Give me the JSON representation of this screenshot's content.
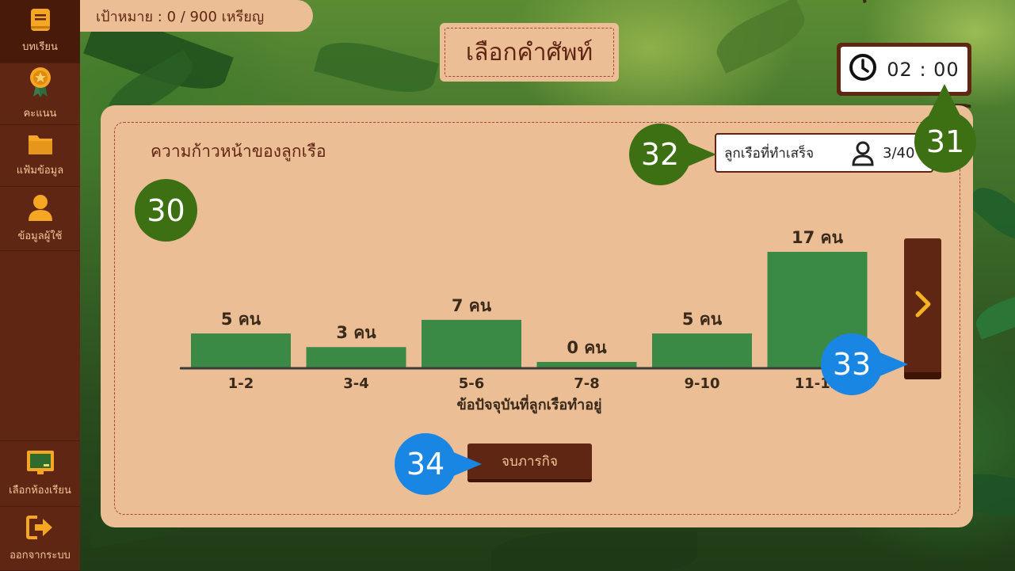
{
  "sidebar": {
    "items": [
      {
        "label": "บทเรียน",
        "icon": "book-icon"
      },
      {
        "label": "คะแนน",
        "icon": "medal-icon"
      },
      {
        "label": "แฟ้มข้อมูล",
        "icon": "folder-icon"
      },
      {
        "label": "ข้อมูลผู้ใช้",
        "icon": "user-icon"
      }
    ],
    "bottom_items": [
      {
        "label": "เลือกห้องเรียน",
        "icon": "classroom-board-icon"
      },
      {
        "label": "ออกจากระบบ",
        "icon": "logout-icon"
      }
    ]
  },
  "header": {
    "goal": "เป้าหมาย : 0 / 900 เหรียญ",
    "title": "เลือกคำศัพท์",
    "timer": "02 : 00"
  },
  "panel": {
    "title": "ความก้าวหน้าของลูกเรือ",
    "crew_label": "ลูกเรือที่ทำเสร็จ",
    "crew_value": "3/40",
    "finish_button": "จบภารกิจ"
  },
  "callouts": [
    "30",
    "31",
    "32",
    "33",
    "34"
  ],
  "colors": {
    "sidebar": "#5f2613",
    "panel": "#ecbe95",
    "bar": "#3a8a45",
    "accent_arrow": "#f5b320",
    "callout_green": "#3c7013",
    "callout_blue": "#1a86e3"
  },
  "chart_data": {
    "type": "bar",
    "categories": [
      "1-2",
      "3-4",
      "5-6",
      "7-8",
      "9-10",
      "11-12"
    ],
    "values": [
      5,
      3,
      7,
      0,
      5,
      17
    ],
    "data_labels": [
      "5 คน",
      "3 คน",
      "7 คน",
      "0 คน",
      "5 คน",
      "17 คน"
    ],
    "xlabel": "ข้อปัจจุบันที่ลูกเรือทำอยู่",
    "ylabel": "",
    "ylim": [
      0,
      17
    ],
    "grid": false,
    "legend": "none"
  }
}
